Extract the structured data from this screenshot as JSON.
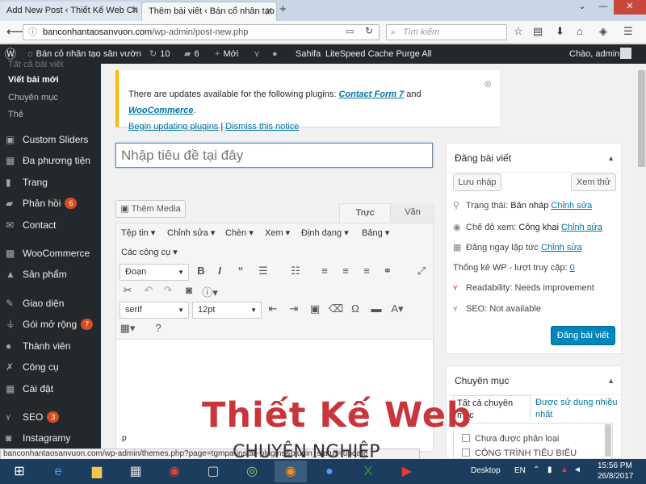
{
  "browser": {
    "tabs": [
      "Add New Post ‹ Thiết Kế Web Ch",
      "Thêm bài viết ‹ Bán cổ nhân tạo s"
    ],
    "url_domain": "banconhantaosanvuon.com",
    "url_path": "/wp-admin/post-new.php",
    "search_placeholder": "Tìm kiếm"
  },
  "adminbar": {
    "site_name": "Bán cỏ nhân tạo sân vườn",
    "updates": "10",
    "comments": "6",
    "new": "Mới",
    "sahifa": "Sahifa",
    "litespeed": "LiteSpeed Cache Purge All",
    "greeting": "Chào, admin"
  },
  "sidebar": {
    "top_cut": "Tất cả bài viết",
    "sub_items": [
      "Viết bài mới",
      "Chuyên mục",
      "Thẻ"
    ],
    "items": [
      {
        "label": "Custom Sliders",
        "icon": "slider-icon"
      },
      {
        "label": "Đa phương tiện",
        "icon": "media-icon"
      },
      {
        "label": "Trang",
        "icon": "page-icon"
      },
      {
        "label": "Phản hồi",
        "icon": "comment-icon",
        "badge": "6"
      },
      {
        "label": "Contact",
        "icon": "mail-icon"
      },
      {
        "label": "WooCommerce",
        "icon": "woocommerce-icon"
      },
      {
        "label": "Sản phẩm",
        "icon": "product-icon"
      },
      {
        "label": "Giao diện",
        "icon": "appearance-icon"
      },
      {
        "label": "Gói mở rộng",
        "icon": "plugin-icon",
        "badge": "7"
      },
      {
        "label": "Thành viên",
        "icon": "user-icon"
      },
      {
        "label": "Công cụ",
        "icon": "wrench-icon"
      },
      {
        "label": "Cài đặt",
        "icon": "settings-icon"
      },
      {
        "label": "SEO",
        "icon": "yoast-icon",
        "badge": "3"
      },
      {
        "label": "Instagramy",
        "icon": "instagram-icon"
      }
    ]
  },
  "notice": {
    "text_before": "There are updates available for the following plugins: ",
    "plugin1": "Contact Form 7",
    "and": " and ",
    "plugin2": "WooCommerce",
    "period": ".",
    "begin_link": "Begin updating plugins",
    "separator": " | ",
    "dismiss_link": "Dismiss this notice"
  },
  "editor": {
    "title_placeholder": "Nhập tiêu đề tại đây",
    "add_media": "Thêm Media",
    "tab_visual": "Trực quan",
    "tab_text": "Văn bản",
    "menus": [
      "Tệp tin",
      "Chỉnh sửa",
      "Chèn",
      "Xem",
      "Định dạng",
      "Bảng",
      "Các công cụ"
    ],
    "format_select": "Đoạn",
    "font_select": "serif",
    "size_select": "12pt",
    "path": "p"
  },
  "publish_box": {
    "title": "Đăng bài viết",
    "save_draft": "Lưu nháp",
    "preview": "Xem thử",
    "status_label": "Trạng thái: ",
    "status_value": "Bản nháp",
    "visibility_label": "Chế độ xem: ",
    "visibility_value": "Công khai",
    "schedule": "Đăng ngay lập tức",
    "edit": "Chỉnh sửa",
    "stats": "Thống kê WP - lượt truy cập: ",
    "stats_value": "0",
    "readability": "Readability: Needs improvement",
    "seo": "SEO: Not available",
    "publish": "Đăng bài viết"
  },
  "category_box": {
    "title": "Chuyên mục",
    "tab_all": "Tất cả chuyên mục",
    "tab_popular": "Được sử dụng nhiều nhất",
    "items": [
      "Chưa được phân loại",
      "CÔNG TRÌNH TIÊU BIỂU"
    ]
  },
  "watermark": {
    "line1": "Thiết Kế Web",
    "line2": "CHUYÊN NGHIỆP"
  },
  "statusbar_url": "banconhantaosanvuon.com/wp-admin/themes.php?page=tgmpa-install-plugins&plugin_status=update",
  "taskbar": {
    "desktop": "Desktop",
    "lang": "EN",
    "time": "15:56 PM",
    "date": "26/8/2017"
  },
  "colors": {
    "admin_dark": "#23282d",
    "wp_blue": "#0085ba",
    "notice_yellow": "#ffb900",
    "watermark_red": "#c8353b"
  }
}
